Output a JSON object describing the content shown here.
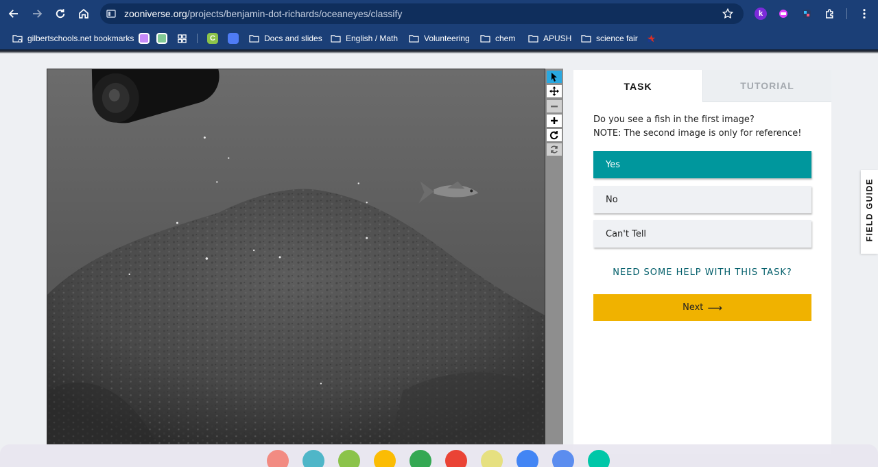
{
  "browser": {
    "url_host": "zooniverse.org",
    "url_path": "/projects/benjamin-dot-richards/oceaneyes/classify",
    "extension_k_label": "k",
    "bookmarks": [
      {
        "label": "gilbertschools.net bookmarks",
        "icon": "managed-folder-icon"
      },
      {
        "label": "Docs and slides",
        "icon": "folder-icon"
      },
      {
        "label": "English / Math",
        "icon": "folder-icon"
      },
      {
        "label": "Volunteering",
        "icon": "folder-icon"
      },
      {
        "label": "chem",
        "icon": "folder-icon"
      },
      {
        "label": "APUSH",
        "icon": "folder-icon"
      },
      {
        "label": "science fair",
        "icon": "folder-icon"
      }
    ],
    "bookmark_app_c_label": "C"
  },
  "viewer": {
    "image_description_icon": "underwater-fish-photo"
  },
  "task_panel": {
    "tabs": {
      "task": "TASK",
      "tutorial": "TUTORIAL"
    },
    "question_line1": "Do you see a fish in the first image?",
    "question_line2": "NOTE: The second image is only for reference!",
    "answers": [
      "Yes",
      "No",
      "Can't Tell"
    ],
    "selected_answer": "Yes",
    "help_link": "NEED SOME HELP WITH THIS TASK?",
    "next_label": "Next",
    "next_arrow": "⟶"
  },
  "field_guide": {
    "label": "FIELD GUIDE"
  },
  "colors": {
    "chrome": "#1b3f77",
    "selected_answer": "#00979d",
    "next_button": "#f0b200",
    "help_link": "#005d69"
  }
}
